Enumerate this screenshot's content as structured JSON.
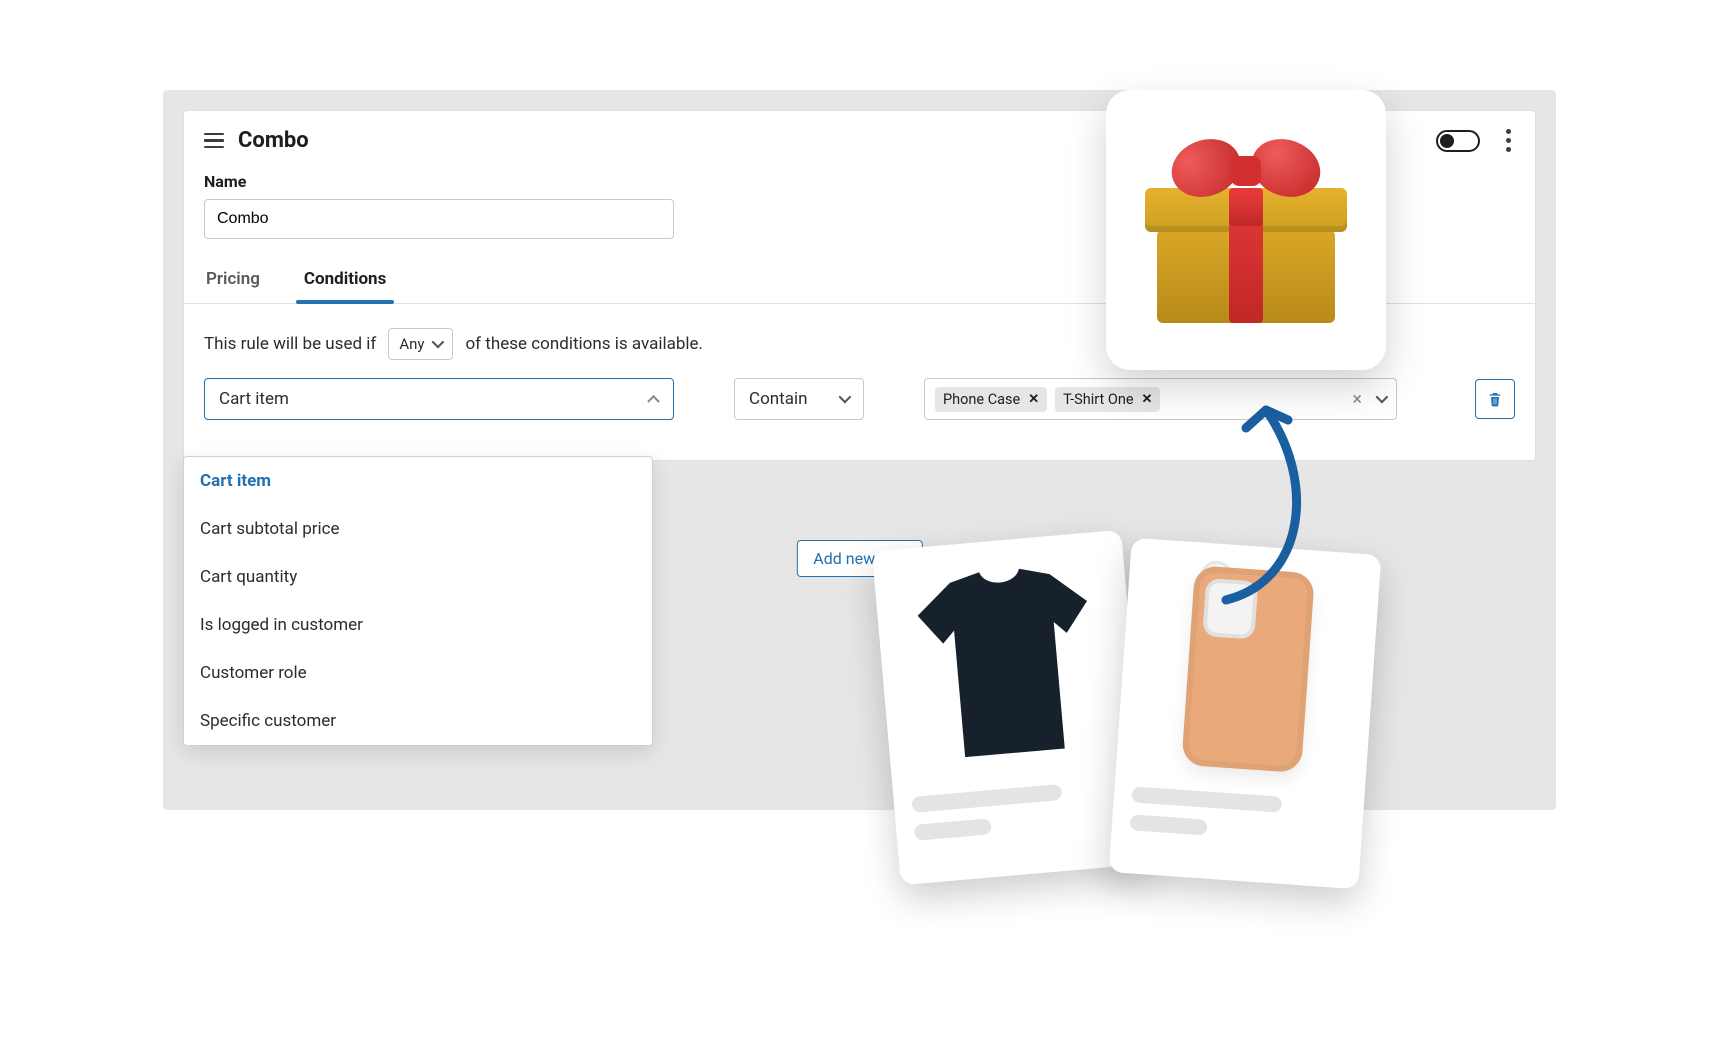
{
  "header": {
    "title": "Combo"
  },
  "name_field": {
    "label": "Name",
    "value": "Combo"
  },
  "tabs": {
    "pricing": "Pricing",
    "conditions": "Conditions"
  },
  "sentence": {
    "part1": "This rule will be used if",
    "mode": "Any",
    "part2": "of these conditions is available."
  },
  "row": {
    "lhs_value": "Cart item",
    "op_value": "Contain",
    "tags": [
      "Phone Case",
      "T-Shirt One"
    ]
  },
  "dropdown_options": [
    "Cart item",
    "Cart subtotal price",
    "Cart quantity",
    "Is logged in customer",
    "Customer role",
    "Specific customer"
  ],
  "add_rule_label": "Add new rule"
}
